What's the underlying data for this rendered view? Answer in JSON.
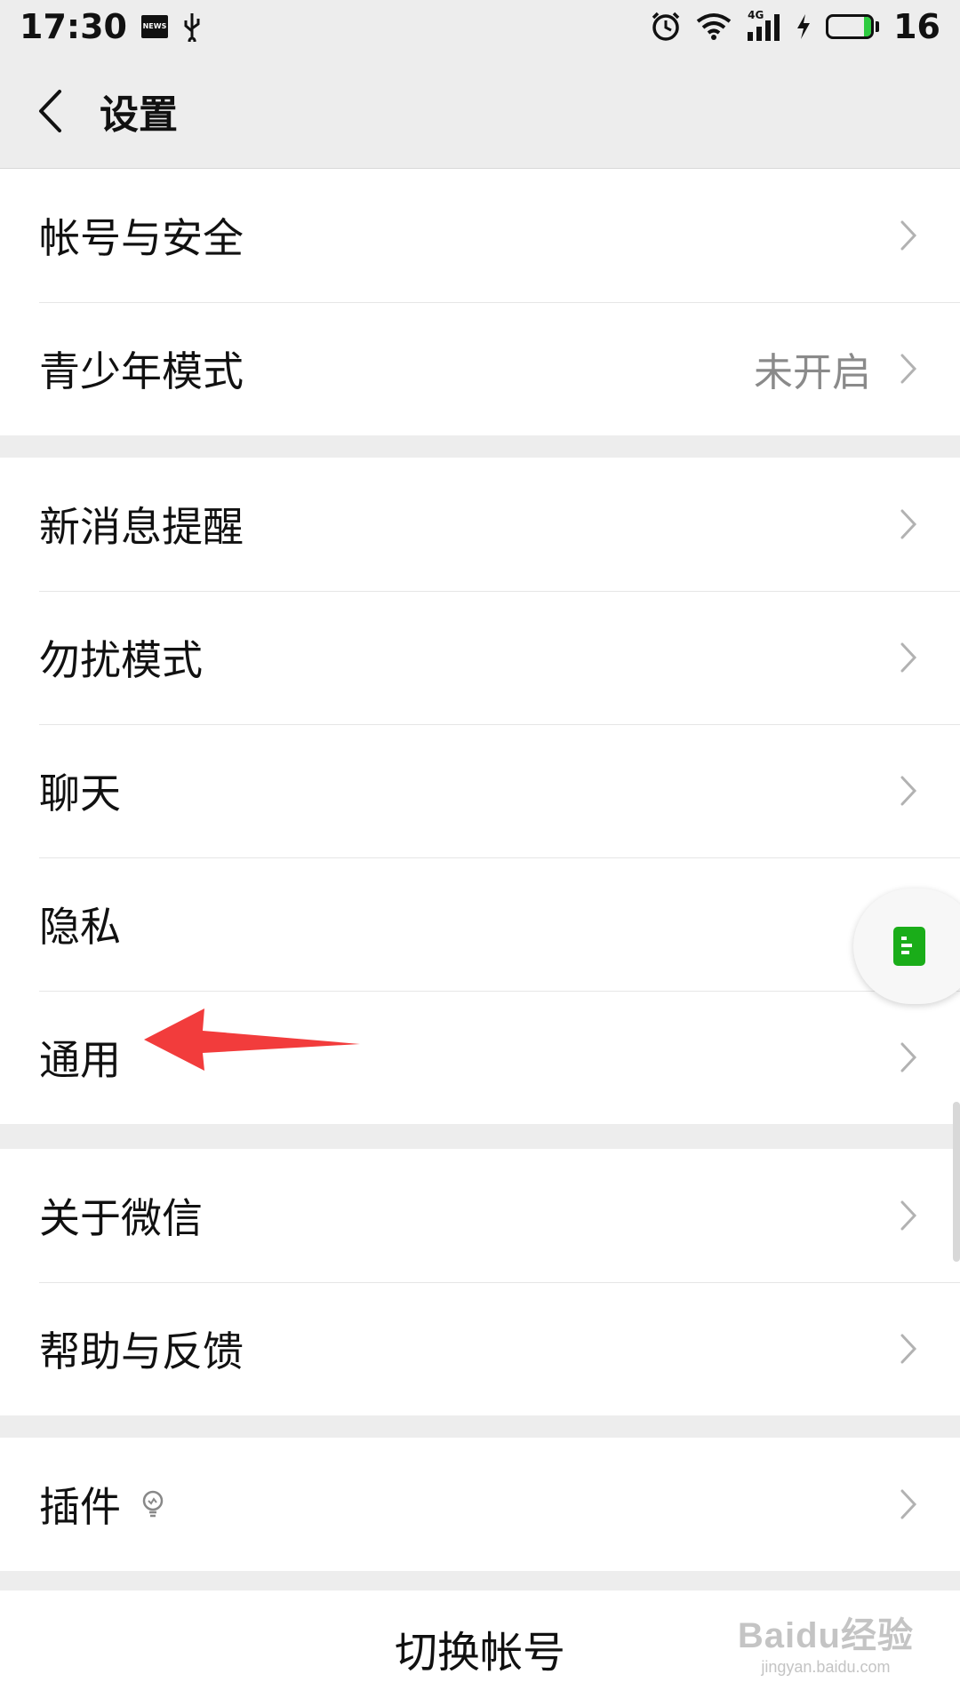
{
  "status_bar": {
    "time": "17:30",
    "news_icon_text": "NEWS",
    "network": "4G",
    "battery_level": "16",
    "battery_fraction": 0.16,
    "icons": [
      "news-icon",
      "usb-icon",
      "alarm-icon",
      "wifi-icon",
      "signal-icon",
      "charging-icon",
      "battery-icon"
    ]
  },
  "nav": {
    "title": "设置",
    "back_icon": "chevron-left-icon"
  },
  "groups": [
    {
      "items": [
        {
          "label": "帐号与安全"
        },
        {
          "label": "青少年模式",
          "value": "未开启"
        }
      ]
    },
    {
      "items": [
        {
          "label": "新消息提醒"
        },
        {
          "label": "勿扰模式"
        },
        {
          "label": "聊天"
        },
        {
          "label": "隐私"
        },
        {
          "label": "通用"
        }
      ]
    },
    {
      "items": [
        {
          "label": "关于微信"
        },
        {
          "label": "帮助与反馈"
        }
      ]
    },
    {
      "items": [
        {
          "label": "插件",
          "icon": "lightbulb-icon"
        }
      ]
    }
  ],
  "switch_account": "切换帐号",
  "floating_button_icon": "document-icon",
  "annotation_arrow_color": "#f23c3c",
  "watermark": {
    "logo": "Baidu经验",
    "url": "jingyan.baidu.com"
  }
}
